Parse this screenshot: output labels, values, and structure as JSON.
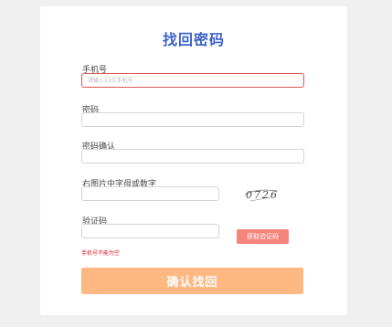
{
  "page": {
    "title": "找回密码"
  },
  "form": {
    "phone": {
      "label": "手机号",
      "placeholder": "请输入11位手机号",
      "value": ""
    },
    "password": {
      "label": "密码",
      "value": ""
    },
    "password_confirm": {
      "label": "密码确认",
      "value": ""
    },
    "captcha": {
      "label": "右图片中字母或数字",
      "value": "",
      "image_text": "0726"
    },
    "sms_code": {
      "label": "验证码",
      "value": "",
      "button_label": "获取验证码"
    },
    "error_message": "手机号不能为空",
    "submit_label": "确认找回"
  },
  "colors": {
    "title": "#3d62c9",
    "error_border": "#e05555",
    "error_text": "#e02020",
    "sms_button": "#f4847c",
    "submit_button": "#ffb882"
  }
}
